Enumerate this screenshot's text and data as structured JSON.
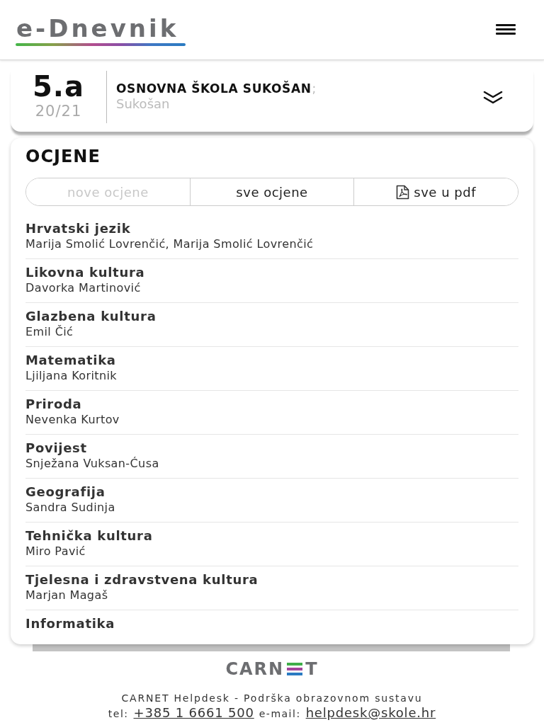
{
  "header": {
    "logo": "e-Dnevnik"
  },
  "class_card": {
    "class_name": "5.a",
    "school_year": "20/21",
    "school_name": "OSNOVNA ŠKOLA SUKOŠAN",
    "separator": ";",
    "place": "Sukošan",
    "expanded": false
  },
  "grades": {
    "title": "OCJENE",
    "segments": [
      {
        "label": "nove ocjene",
        "kind": "plain",
        "disabled": true
      },
      {
        "label": "sve ocjene",
        "kind": "plain",
        "disabled": false
      },
      {
        "label": "sve u pdf",
        "kind": "pdf",
        "disabled": false
      }
    ],
    "subjects": [
      {
        "name": "Hrvatski jezik",
        "teacher": "Marija Smolić Lovrenčić, Marija Smolić Lovrenčić"
      },
      {
        "name": "Likovna kultura",
        "teacher": "Davorka Martinović"
      },
      {
        "name": "Glazbena kultura",
        "teacher": "Emil Čić"
      },
      {
        "name": "Matematika",
        "teacher": "Ljiljana Koritnik"
      },
      {
        "name": "Priroda",
        "teacher": "Nevenka Kurtov"
      },
      {
        "name": "Povijest",
        "teacher": "Snježana Vuksan-Ćusa"
      },
      {
        "name": "Geografija",
        "teacher": "Sandra Sudinja"
      },
      {
        "name": "Tehnička kultura",
        "teacher": "Miro Pavić"
      },
      {
        "name": "Tjelesna i zdravstvena kultura",
        "teacher": "Marjan Magaš"
      },
      {
        "name": "Informatika"
      }
    ]
  },
  "footer": {
    "logo": {
      "before": "CARN",
      "after": "T"
    },
    "helpdesk": "CARNET Helpdesk - Podrška obrazovnom sustavu",
    "contact": [
      {
        "label": "tel:",
        "link": "+385 1 6661 500"
      },
      {
        "label": "e-mail:",
        "link": "helpdesk@skole.hr"
      }
    ]
  }
}
